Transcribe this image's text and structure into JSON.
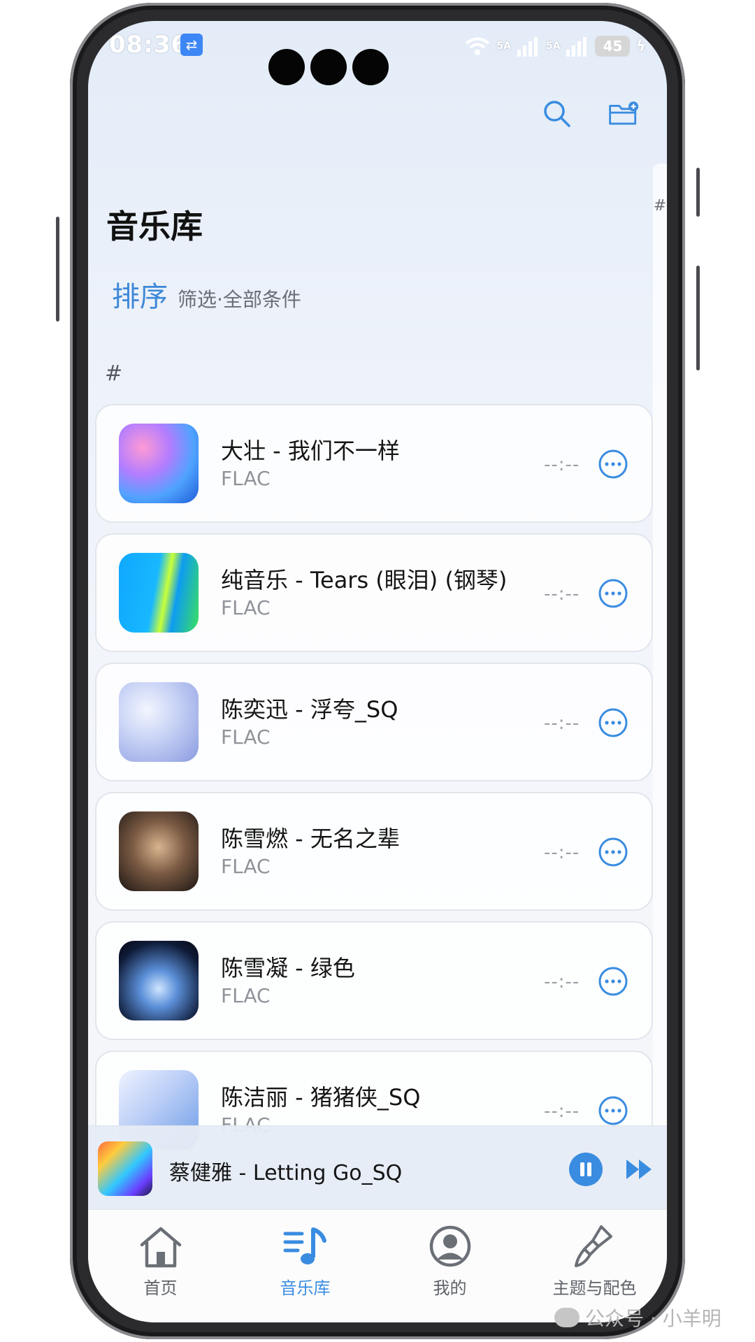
{
  "status": {
    "time": "08:36",
    "signal_1": "5A",
    "signal_2": "5A",
    "battery": "45"
  },
  "header": {
    "title": "音乐库",
    "sort_label": "排序",
    "filter_label": "筛选·全部条件"
  },
  "index_rail": {
    "letter": "#"
  },
  "section": {
    "letter": "#"
  },
  "songs": [
    {
      "title": "大壮 - 我们不一样",
      "format": "FLAC",
      "time": "--:--"
    },
    {
      "title": "纯音乐 - Tears (眼泪) (钢琴)",
      "format": "FLAC",
      "time": "--:--"
    },
    {
      "title": "陈奕迅 - 浮夸_SQ",
      "format": "FLAC",
      "time": "--:--"
    },
    {
      "title": "陈雪燃 - 无名之辈",
      "format": "FLAC",
      "time": "--:--"
    },
    {
      "title": "陈雪凝 - 绿色",
      "format": "FLAC",
      "time": "--:--"
    },
    {
      "title": "陈洁丽 - 猪猪侠_SQ",
      "format": "FLAC",
      "time": "--:--"
    }
  ],
  "now_playing": {
    "title": "蔡健雅 - Letting Go_SQ"
  },
  "nav": [
    {
      "label": "首页",
      "icon": "home-icon"
    },
    {
      "label": "音乐库",
      "icon": "music-library-icon"
    },
    {
      "label": "我的",
      "icon": "profile-icon"
    },
    {
      "label": "主题与配色",
      "icon": "paint-brush-icon"
    }
  ],
  "watermark": {
    "text": "公众号 · 小羊明"
  },
  "colors": {
    "accent": "#3a8ce0",
    "title_text": "#111111",
    "muted_text": "#8f9399"
  }
}
